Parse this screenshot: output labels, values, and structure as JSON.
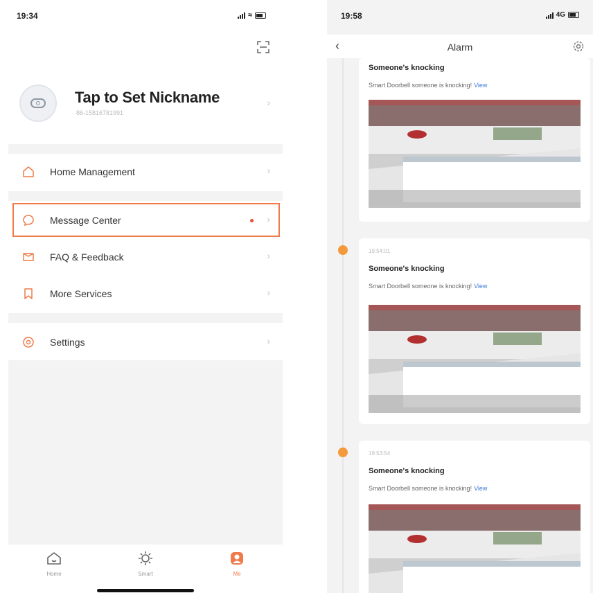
{
  "left_screen": {
    "status_time": "19:34",
    "nickname": "Tap to Set Nickname",
    "account": "86-15816781991",
    "menu": {
      "home_management": "Home Management",
      "message_center": "Message Center",
      "faq_feedback": "FAQ & Feedback",
      "more_services": "More Services",
      "settings": "Settings"
    },
    "tabs": {
      "home": "Home",
      "smart": "Smart",
      "me": "Me"
    }
  },
  "right_screen": {
    "status_time": "19:58",
    "network": "4G",
    "nav_title": "Alarm",
    "alarms": [
      {
        "time": "",
        "title": "Someone's knocking",
        "desc": "Smart Doorbell someone is knocking!",
        "link": "View"
      },
      {
        "time": "19:54:01",
        "title": "Someone's knocking",
        "desc": "Smart Doorbell someone is knocking!",
        "link": "View"
      },
      {
        "time": "19:53:54",
        "title": "Someone's knocking",
        "desc": "Smart Doorbell someone is knocking!",
        "link": "View"
      }
    ]
  },
  "colors": {
    "accent": "#f07a4a",
    "timeline_dot": "#f49a3c",
    "link": "#3a7bd5",
    "unread_dot": "#f04c3a"
  }
}
